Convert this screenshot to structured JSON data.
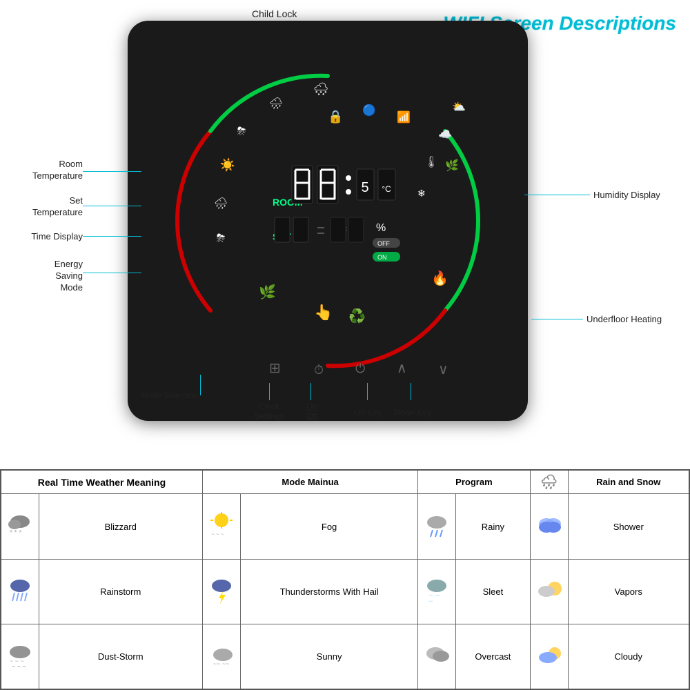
{
  "title": "WIFI Screen Descriptions",
  "annotations": {
    "child_lock": "Child Lock",
    "room_temperature": "Room\nTemperature",
    "set_temperature": "Set\nTemperature",
    "time_display": "Time Display",
    "energy_saving_mode": "Energy\nSaving\nMode",
    "humidity_display": "Humidity Display",
    "underfloor_heating": "Underfloor Heating",
    "mode_selection": "Mode Selection",
    "clock_settings": "Clock\nSettings",
    "on_off": "On\nOff",
    "up_key": "UP Key",
    "down_key": "Down Key"
  },
  "weather_table": {
    "header_col1": "Real Time Weather Meaning",
    "header_col2": "Mode Mainua",
    "header_col3": "Program",
    "header_col4_icon": "🌧*",
    "header_col4_text": "Rain and Snow",
    "rows": [
      {
        "icon1": "🌨",
        "label1": "Blizzard",
        "icon2": "☀️",
        "label2": "Fog",
        "icon3": "🌧",
        "label3": "Rainy",
        "icon4": "💧",
        "label4": "Shower"
      },
      {
        "icon1": "⛈",
        "label1": "Rainstorm",
        "icon2": "⛈",
        "label2": "Thunderstorms With Hail",
        "icon3": "🌨",
        "label3": "Sleet",
        "icon4": "⛅",
        "label4": "Vapors"
      },
      {
        "icon1": "🌪",
        "label1": "Dust-Storm",
        "icon2": "🌫",
        "label2": "Sunny",
        "icon3": "☁️",
        "label3": "Overcast",
        "icon4": "⛅",
        "label4": "Cloudy"
      }
    ]
  }
}
